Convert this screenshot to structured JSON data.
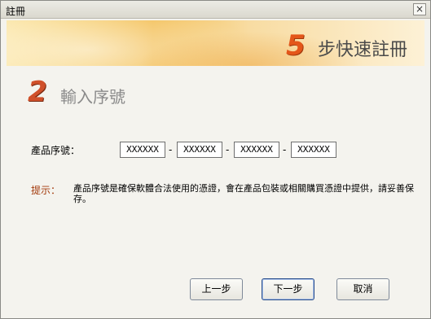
{
  "window": {
    "title": "註冊",
    "close_icon": "×"
  },
  "banner": {
    "number": "5",
    "text": "步快速註冊"
  },
  "step": {
    "number": "2",
    "title": "輸入序號"
  },
  "serial": {
    "label": "產品序號：",
    "fields": [
      "XXXXXX",
      "XXXXXX",
      "XXXXXX",
      "XXXXXX"
    ],
    "separator": "-"
  },
  "tip": {
    "label": "提示：",
    "text": "產品序號是確保軟體合法使用的憑證，會在產品包裝或相關購買憑證中提供，請妥善保存。"
  },
  "buttons": {
    "prev": "上一步",
    "next": "下一步",
    "cancel": "取消"
  },
  "colors": {
    "accent": "#e4561a",
    "banner": "#f3bf55"
  }
}
